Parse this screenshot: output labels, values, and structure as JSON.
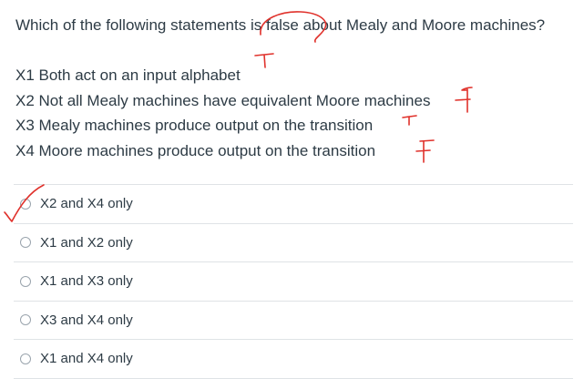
{
  "question": {
    "text": "Which of the following statements is false about Mealy and Moore machines?"
  },
  "statements": [
    "X1 Both act on an input alphabet",
    "X2 Not all Mealy machines have equivalent Moore machines",
    "X3 Mealy machines produce output on the transition",
    "X4 Moore machines produce output on the transition"
  ],
  "options": [
    {
      "label": "X2 and X4 only",
      "marked_correct": true
    },
    {
      "label": "X1 and X2 only",
      "marked_correct": false
    },
    {
      "label": "X1 and X3 only",
      "marked_correct": false
    },
    {
      "label": "X3 and X4 only",
      "marked_correct": false
    },
    {
      "label": "X1 and X4 only",
      "marked_correct": false
    }
  ],
  "annotations": {
    "ink_color": "#e0312b",
    "handwritten_marks": [
      "T",
      "F",
      "T",
      "F"
    ]
  }
}
